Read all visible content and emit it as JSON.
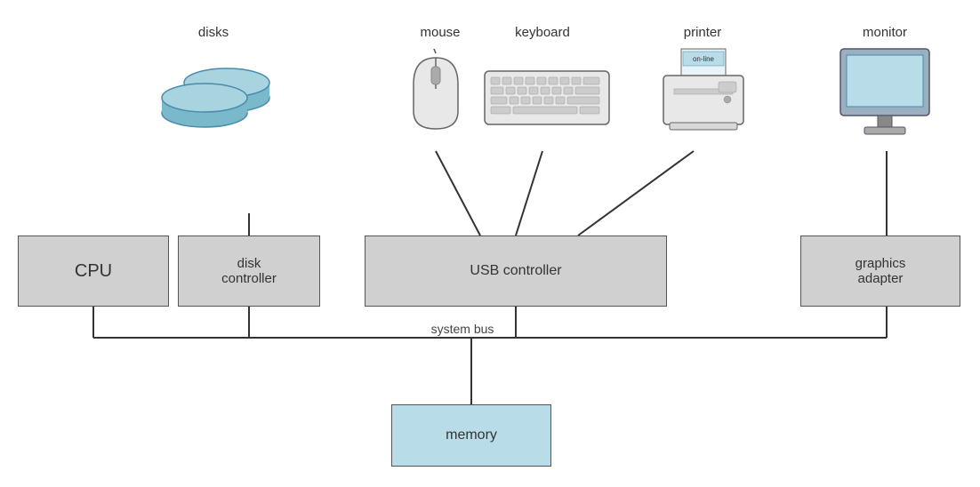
{
  "labels": {
    "disks": "disks",
    "mouse": "mouse",
    "keyboard": "keyboard",
    "printer": "printer",
    "monitor": "monitor",
    "system_bus": "system bus",
    "cpu": "CPU",
    "disk_controller": "disk\ncontroller",
    "usb_controller": "USB controller",
    "graphics_adapter": "graphics\nadapter",
    "memory": "memory"
  },
  "colors": {
    "box_gray": "#d0d0d0",
    "box_blue": "#b8dce8",
    "border": "#555",
    "line": "#333",
    "disk_fill": "#7ab8cc",
    "disk_stroke": "#4a8aaa"
  }
}
